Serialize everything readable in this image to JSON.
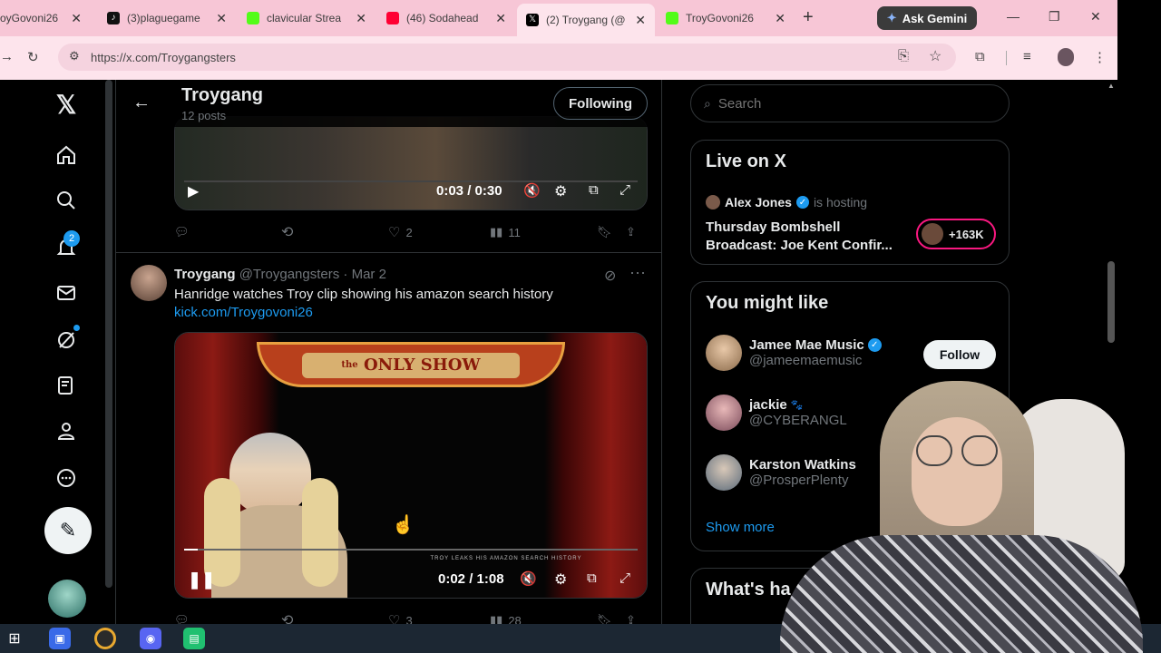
{
  "browser": {
    "tabs": [
      {
        "title": "oyGovoni26",
        "icon_color": "#53fc18"
      },
      {
        "title": "(3)plaguegame",
        "icon_color": "#111111"
      },
      {
        "title": "clavicular Strea",
        "icon_color": "#53fc18"
      },
      {
        "title": "(46) Sodahead",
        "icon_color": "#ff0033"
      },
      {
        "title": "(2) Troygang (@",
        "icon_color": "#000000"
      },
      {
        "title": "TroyGovoni26",
        "icon_color": "#53fc18"
      }
    ],
    "new_tab_label": "+",
    "gemini_label": "Ask Gemini",
    "url": "https://x.com/Troygangsters"
  },
  "profile_header": {
    "name": "Troygang",
    "posts": "12 posts",
    "following_label": "Following"
  },
  "nav": {
    "notifications_badge": "2"
  },
  "post1": {
    "video_time": "0:03 / 0:30",
    "replies": "",
    "reposts": "",
    "likes": "2",
    "views": "11"
  },
  "post2": {
    "author": "Troygang",
    "handle": "@Troygangsters",
    "date": "· Mar 2",
    "text": "Hanridge watches Troy clip showing his amazon search history",
    "link": "kick.com/Troygovoni26",
    "video_sign": "ONLY SHOW",
    "video_sign_small": "the",
    "video_caption": "TROY LEAKS HIS AMAZON SEARCH HISTORY",
    "video_time": "0:02 / 1:08",
    "video_progress": 0.03,
    "likes": "3",
    "views": "28"
  },
  "search": {
    "placeholder": "Search"
  },
  "live": {
    "heading": "Live on X",
    "host": "Alex Jones",
    "hosting_label": "is hosting",
    "title": "Thursday Bombshell Broadcast: Joe Kent Confir...",
    "listeners": "+163K"
  },
  "you_might_like": {
    "heading": "You might like",
    "users": [
      {
        "name": "Jamee Mae Music",
        "handle": "@jameemaemusic",
        "verified": true
      },
      {
        "name": "jackie",
        "handle": "@CYBERANGL",
        "verified": false
      },
      {
        "name": "Karston Watkins",
        "handle": "@ProsperPlenty",
        "verified": false
      }
    ],
    "follow_label": "Follow",
    "show_more": "Show more"
  },
  "whats_happening": {
    "heading": "What's ha"
  },
  "colors": {
    "accent": "#1d9bf0",
    "link": "#1d9bf0",
    "tabstrip": "#f7c6d6",
    "live_ring": "#f91880"
  }
}
